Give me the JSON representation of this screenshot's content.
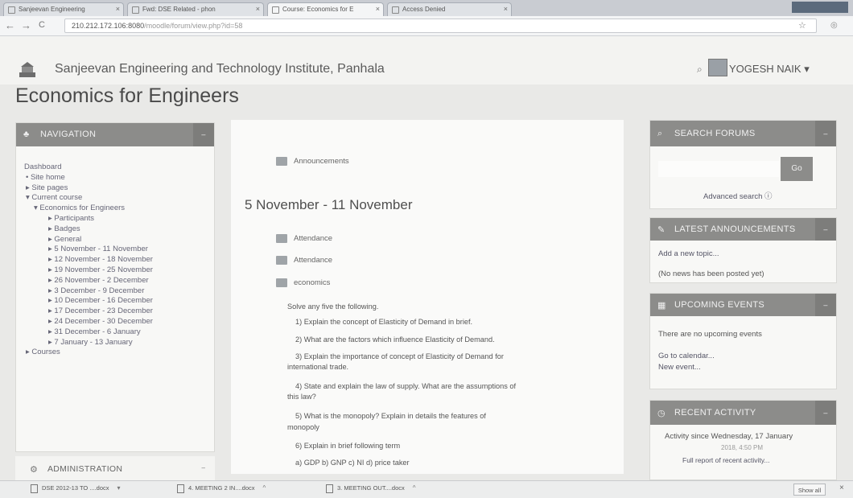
{
  "browser": {
    "tabs": [
      {
        "label": "Sanjeevan Engineering"
      },
      {
        "label": "Fwd: DSE Related - phon"
      },
      {
        "label": "Course: Economics for E"
      },
      {
        "label": "Access Denied"
      }
    ],
    "url_host": "210.212.172.106:8080",
    "url_path": "/moodle/forum/view.php?id=58"
  },
  "site": {
    "name": "Sanjeevan Engineering and Technology Institute, Panhala",
    "user": "YOGESH NAIK"
  },
  "course_title": "Economics for Engineers",
  "navigation": {
    "title": "NAVIGATION",
    "items": [
      "Dashboard",
      "Site home",
      "Site pages",
      "Current course",
      "Economics for Engineers",
      "Participants",
      "Badges",
      "General",
      "5 November - 11 November",
      "12 November - 18 November",
      "19 November - 25 November",
      "26 November - 2 December",
      "3 December - 9 December",
      "10 December - 16 December",
      "17 December - 23 December",
      "24 December - 30 December",
      "31 December - 6 January",
      "7 January - 13 January",
      "Courses"
    ]
  },
  "administration": {
    "title": "ADMINISTRATION"
  },
  "main": {
    "announcements": "Announcements",
    "section_title": "5 November - 11 November",
    "activities": [
      "Attendance",
      "Attendance",
      "economics"
    ],
    "questions": [
      "Solve any five the following.",
      "1)     Explain the concept of Elasticity of Demand in brief.",
      "2)     What are the factors which influence Elasticity of Demand.",
      "3)     Explain the importance of concept of Elasticity of Demand for",
      "international trade.",
      "4)     State and explain the law of supply. What are the assumptions of",
      "this law?",
      "5)     What is the monopoly? Explain in details the features of",
      "monopoly",
      "6)     Explain in brief following term",
      "a)     GDP    b) GNP   c) NI   d) price taker"
    ]
  },
  "search_forums": {
    "title": "SEARCH FORUMS",
    "go": "Go",
    "advanced": "Advanced search"
  },
  "latest_announcements": {
    "title": "LATEST ANNOUNCEMENTS",
    "add_topic": "Add a new topic...",
    "no_news": "(No news has been posted yet)"
  },
  "upcoming_events": {
    "title": "UPCOMING EVENTS",
    "none": "There are no upcoming events",
    "calendar": "Go to calendar...",
    "new_event": "New event..."
  },
  "recent_activity": {
    "title": "RECENT ACTIVITY",
    "since_1": "Activity since Wednesday, 17 January",
    "since_2": "2018, 4:50 PM",
    "full_report": "Full report of recent activity..."
  },
  "downloads": {
    "items": [
      "DSE 2012-13 TO ....docx",
      "4. MEETING 2 IN....docx",
      "3. MEETING OUT....docx"
    ],
    "show_all": "Show all"
  }
}
